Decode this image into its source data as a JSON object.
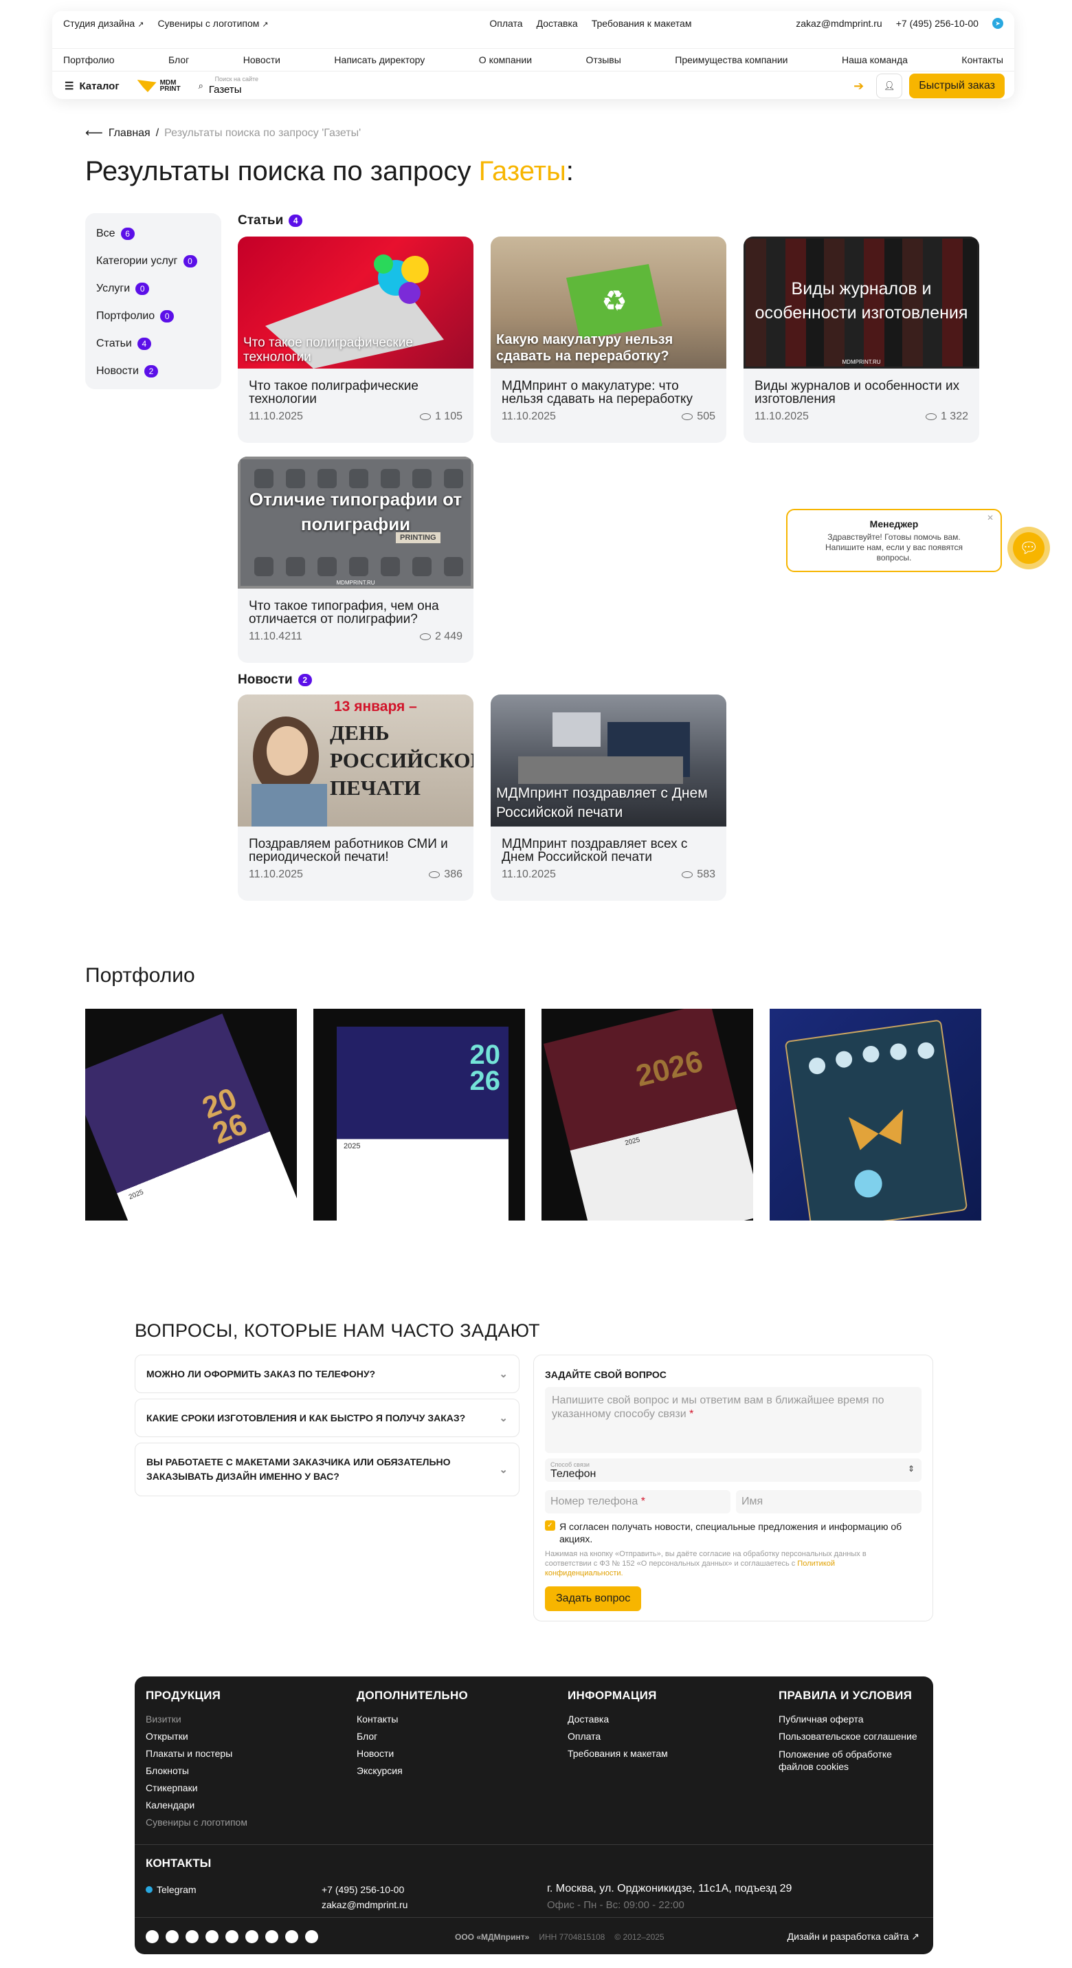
{
  "header": {
    "top_left": [
      "Студия дизайна",
      "Сувениры с логотипом"
    ],
    "top_center": [
      "Оплата",
      "Доставка",
      "Требования к макетам"
    ],
    "email": "zakaz@mdmprint.ru",
    "phone": "+7 (495) 256-10-00",
    "nav": [
      "Портфолио",
      "Блог",
      "Новости",
      "Написать директору",
      "О компании",
      "Отзывы",
      "Преимущества компании",
      "Наша команда",
      "Контакты"
    ],
    "catalog_label": "Каталог",
    "logo_text_1": "MDM",
    "logo_text_2": "PRINT",
    "search_label": "Поиск на сайте",
    "search_value": "Газеты",
    "quick_order": "Быстрый заказ"
  },
  "breadcrumb": {
    "home": "Главная",
    "sep": "/",
    "current": "Результаты поиска по запросу 'Газеты'"
  },
  "page_title": {
    "prefix": "Результаты поиска по запросу ",
    "query": "Газеты",
    "suffix": ":"
  },
  "filters": [
    {
      "label": "Все",
      "count": "6"
    },
    {
      "label": "Категории услуг",
      "count": "0"
    },
    {
      "label": "Услуги",
      "count": "0"
    },
    {
      "label": "Портфолио",
      "count": "0"
    },
    {
      "label": "Статьи",
      "count": "4"
    },
    {
      "label": "Новости",
      "count": "2"
    }
  ],
  "articles": {
    "title": "Статьи",
    "count": "4",
    "items": [
      {
        "title": "Что такое полиграфические технологии",
        "date": "11.10.2025",
        "views": "1 105",
        "overlay": "Что такое полиграфические технологии"
      },
      {
        "title": "МДМпринт о макулатуре: что нельзя сдавать на переработку",
        "date": "11.10.2025",
        "views": "505",
        "overlay": "Какую макулатуру нельзя сдавать на переработку?"
      },
      {
        "title": "Виды журналов и особенности их изготовления",
        "date": "11.10.2025",
        "views": "1 322",
        "overlay": "Виды журналов и особенности изготовления",
        "watermark": "MDMPRINT.RU"
      },
      {
        "title": "Что такое типография, чем она отличается от полиграфии?",
        "date": "11.10.4211",
        "views": "2 449",
        "overlay": "Отличие типографии от полиграфии",
        "sign": "PRINTING",
        "watermark": "MDMPRINT.RU"
      }
    ]
  },
  "news": {
    "title": "Новости",
    "count": "2",
    "items": [
      {
        "title": "Поздравляем работников СМИ и периодической печати!",
        "date": "11.10.2025",
        "views": "386",
        "overlay_date": "13 января –",
        "overlay": "день российской печати"
      },
      {
        "title": "МДМпринт поздравляет всех с Днем Российской печати",
        "date": "11.10.2025",
        "views": "583",
        "overlay": "МДМпринт поздравляет с Днем Российской печати"
      }
    ]
  },
  "chat_widget": {
    "title": "Менеджер",
    "text": "Здравствуйте! Готовы помочь вам. Напишите нам, если у вас появятся вопросы."
  },
  "portfolio": {
    "title": "Портфолио",
    "tiles": [
      {
        "year_top": "20",
        "year_bottom": "26",
        "cal_year": "2025"
      },
      {
        "year_top": "20",
        "year_bottom": "26",
        "cal_year": "2025"
      },
      {
        "year_top": "20",
        "year_bottom": "26",
        "cal_year": "2025"
      },
      {
        "year_top": "",
        "year_bottom": "",
        "cal_year": ""
      }
    ]
  },
  "faq": {
    "title": "ВОПРОСЫ, КОТОРЫЕ НАМ ЧАСТО ЗАДАЮТ",
    "items": [
      "МОЖНО ЛИ ОФОРМИТЬ ЗАКАЗ ПО ТЕЛЕФОНУ?",
      "КАКИЕ СРОКИ ИЗГОТОВЛЕНИЯ И КАК БЫСТРО Я ПОЛУЧУ ЗАКАЗ?",
      "ВЫ РАБОТАЕТЕ С МАКЕТАМИ ЗАКАЗЧИКА ИЛИ ОБЯЗАТЕЛЬНО ЗАКАЗЫВАТЬ ДИЗАЙН ИМЕННО У ВАС?"
    ]
  },
  "ask_form": {
    "title": "ЗАДАЙТЕ СВОЙ ВОПРОС",
    "question_placeholder": "Напишите свой вопрос и мы ответим вам в ближайшее время по указанному способу связи",
    "contact_label": "Способ связи",
    "contact_value": "Телефон",
    "phone_placeholder": "Номер телефона",
    "name_placeholder": "Имя",
    "consent": "Я согласен получать новости, специальные предложения и информацию об акциях.",
    "legal": "Нажимая на кнопку «Отправить», вы даёте согласие на обработку персональных данных в соответствии с ФЗ № 152 «О персональных данных» и соглашаетесь с",
    "legal_link": "Политикой конфиденциальности.",
    "submit": "Задать вопрос"
  },
  "footer": {
    "col1": {
      "title": "ПРОДУКЦИЯ",
      "items": [
        "Визитки",
        "Открытки",
        "Плакаты и постеры",
        "Блокноты",
        "Стикерпаки",
        "Календари",
        "Сувениры с логотипом"
      ]
    },
    "col2": {
      "title": "ДОПОЛНИТЕЛЬНО",
      "items": [
        "Контакты",
        "Блог",
        "Новости",
        "Экскурсия"
      ]
    },
    "col3": {
      "title": "ИНФОРМАЦИЯ",
      "items": [
        "Доставка",
        "Оплата",
        "Требования к макетам"
      ]
    },
    "col4": {
      "title": "ПРАВИЛА И УСЛОВИЯ",
      "items": [
        "Публичная оферта",
        "Пользовательское соглашение",
        "Положение об обработке файлов cookies"
      ]
    },
    "contacts_title": "КОНТАКТЫ",
    "telegram": "Telegram",
    "phone": "+7 (495) 256-10-00",
    "email": "zakaz@mdmprint.ru",
    "address": "г. Москва, ул. Орджоникидзе, 11с1А, подъезд 29",
    "hours": "Офис - Пн - Вс: 09:00 - 22:00",
    "company": "ООО «МДМпринт»",
    "inn": "ИНН 7704815108",
    "copyright": "© 2012–2025",
    "dev": "Дизайн и разработка сайта"
  },
  "colors": {
    "accent": "#f7b500",
    "badge": "#5b0fe8",
    "footer_bg": "#1b1b1b"
  }
}
